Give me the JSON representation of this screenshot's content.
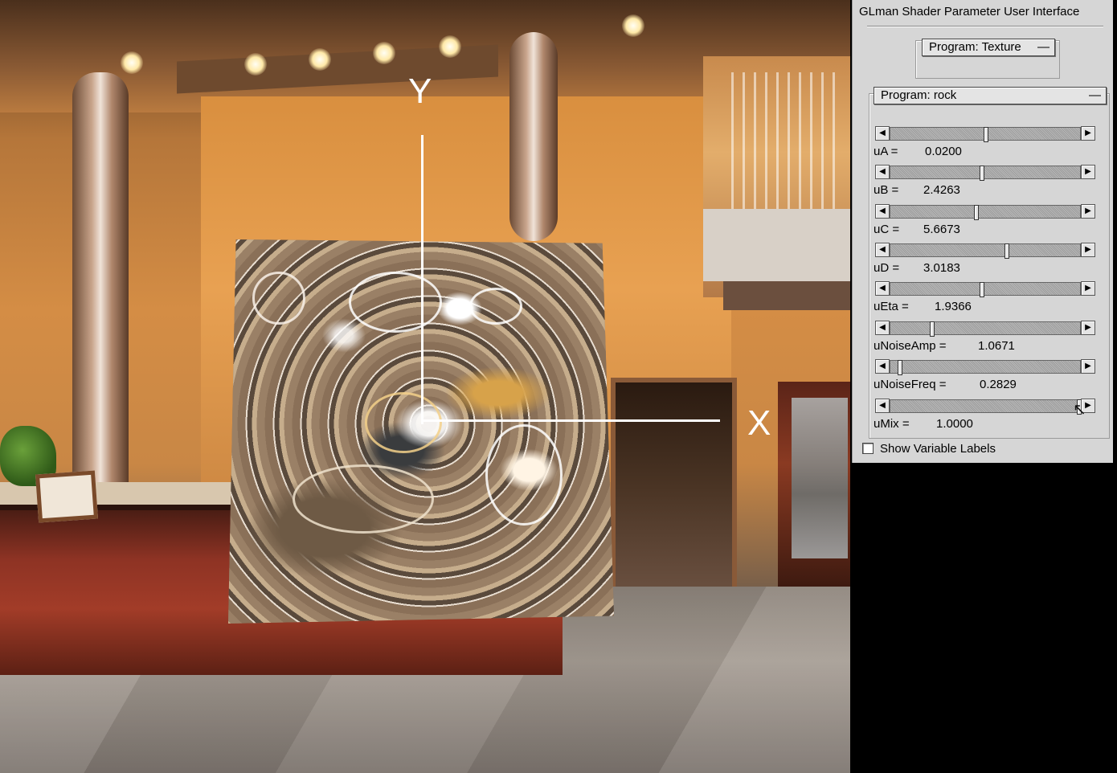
{
  "window": {
    "title": "GLman Shader Parameter User Interface"
  },
  "program_top": {
    "label": "Program: Texture",
    "toggle": "—"
  },
  "program_group": {
    "label": "Program: rock",
    "toggle": "—",
    "uniforms": [
      {
        "name": "uA =",
        "value": "0.0200",
        "fraction": 0.5
      },
      {
        "name": "uB =",
        "value": "2.4263",
        "fraction": 0.48
      },
      {
        "name": "uC =",
        "value": "5.6673",
        "fraction": 0.45
      },
      {
        "name": "uD =",
        "value": "3.0183",
        "fraction": 0.61
      },
      {
        "name": "uEta =",
        "value": "1.9366",
        "fraction": 0.48
      },
      {
        "name": "uNoiseAmp =",
        "value": "1.0671",
        "fraction": 0.21
      },
      {
        "name": "uNoiseFreq =",
        "value": "0.2829",
        "fraction": 0.04
      },
      {
        "name": "uMix =",
        "value": "1.0000",
        "fraction": 1.0
      }
    ]
  },
  "show_labels": {
    "label": "Show Variable Labels",
    "checked": false
  },
  "axes": {
    "x_label": "X",
    "y_label": "Y"
  },
  "icons": {
    "arrow_left": "◀",
    "arrow_right": "▶",
    "cursor": "mouse-pointer-icon"
  }
}
